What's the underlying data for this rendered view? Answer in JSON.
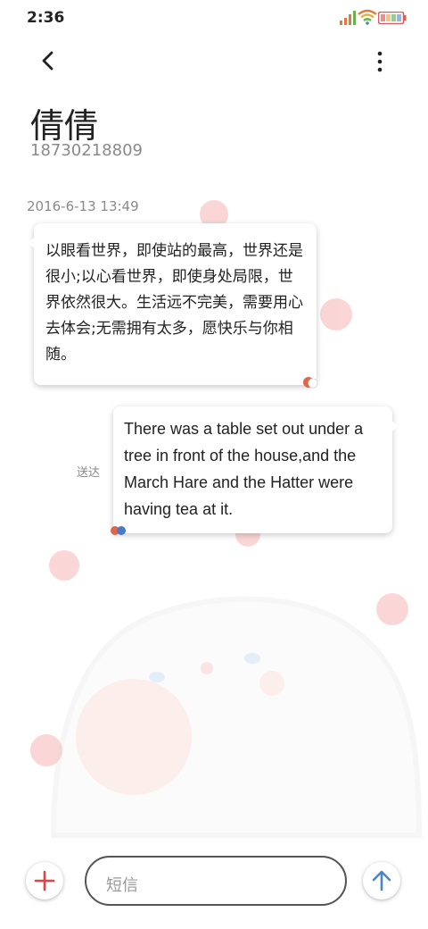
{
  "status_bar": {
    "time": "2:36"
  },
  "contact": {
    "name": "倩倩",
    "number": "18730218809"
  },
  "conversation": {
    "timestamp": "2016-6-13 13:49",
    "incoming_message": "以眼看世界，即使站的最高，世界还是很小;以心看世界，即使身处局限，世界依然很大。生活远不完美，需要用心去体会;无需拥有太多，愿快乐与你相随。",
    "outgoing_message": "There was a table set out under a tree in front of the house,and the March Hare and the Hatter were having tea at it.",
    "delivery_status": "送达"
  },
  "composer": {
    "placeholder": "短信"
  },
  "icons": {
    "back": "back-arrow-icon",
    "menu": "more-vertical-icon",
    "add": "plus-icon",
    "send": "send-arrow-icon"
  },
  "colors": {
    "add_accent": "#e04545",
    "send_accent": "#4a86c8"
  }
}
